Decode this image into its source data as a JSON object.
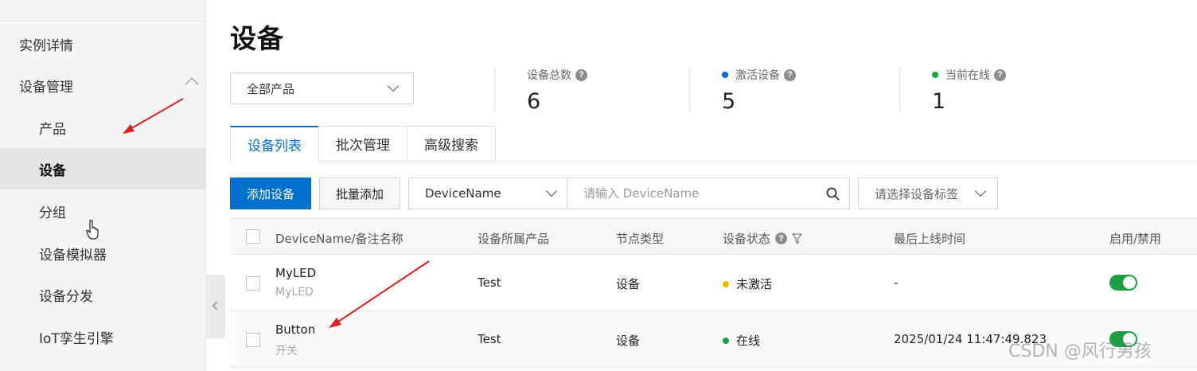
{
  "sidebar": {
    "items": [
      {
        "label": "实例详情"
      },
      {
        "label": "设备管理"
      },
      {
        "label": "产品"
      },
      {
        "label": "设备"
      },
      {
        "label": "分组"
      },
      {
        "label": "设备模拟器"
      },
      {
        "label": "设备分发"
      },
      {
        "label": "IoT孪生引擎"
      }
    ]
  },
  "page": {
    "title": "设备"
  },
  "product_filter": {
    "selected": "全部产品"
  },
  "stats": [
    {
      "label": "设备总数",
      "value": "6"
    },
    {
      "label": "激活设备",
      "value": "5",
      "dot_color": "#0070cc"
    },
    {
      "label": "当前在线",
      "value": "1",
      "dot_color": "#1e9e45"
    }
  ],
  "tabs": [
    {
      "label": "设备列表"
    },
    {
      "label": "批次管理"
    },
    {
      "label": "高级搜索"
    }
  ],
  "toolbar": {
    "add_label": "添加设备",
    "batch_add_label": "批量添加",
    "field_select": "DeviceName",
    "search_placeholder": "请输入 DeviceName",
    "tag_select_placeholder": "请选择设备标签"
  },
  "table": {
    "columns": [
      "DeviceName/备注名称",
      "设备所属产品",
      "节点类型",
      "设备状态",
      "最后上线时间",
      "启用/禁用"
    ],
    "rows": [
      {
        "name": "MyLED",
        "note": "MyLED",
        "product": "Test",
        "node_type": "设备",
        "status": "未激活",
        "status_color": "#f5b800",
        "last_online": "-",
        "enabled": true
      },
      {
        "name": "Button",
        "note": "开关",
        "product": "Test",
        "node_type": "设备",
        "status": "在线",
        "status_color": "#1e9e45",
        "last_online": "2025/01/24 11:47:49.823",
        "enabled": true
      }
    ]
  },
  "watermark": "CSDN @风行男孩",
  "colors": {
    "accent": "#0070cc",
    "annotation_arrow": "#e02020",
    "online": "#1e9e45",
    "inactive": "#f5b800"
  }
}
